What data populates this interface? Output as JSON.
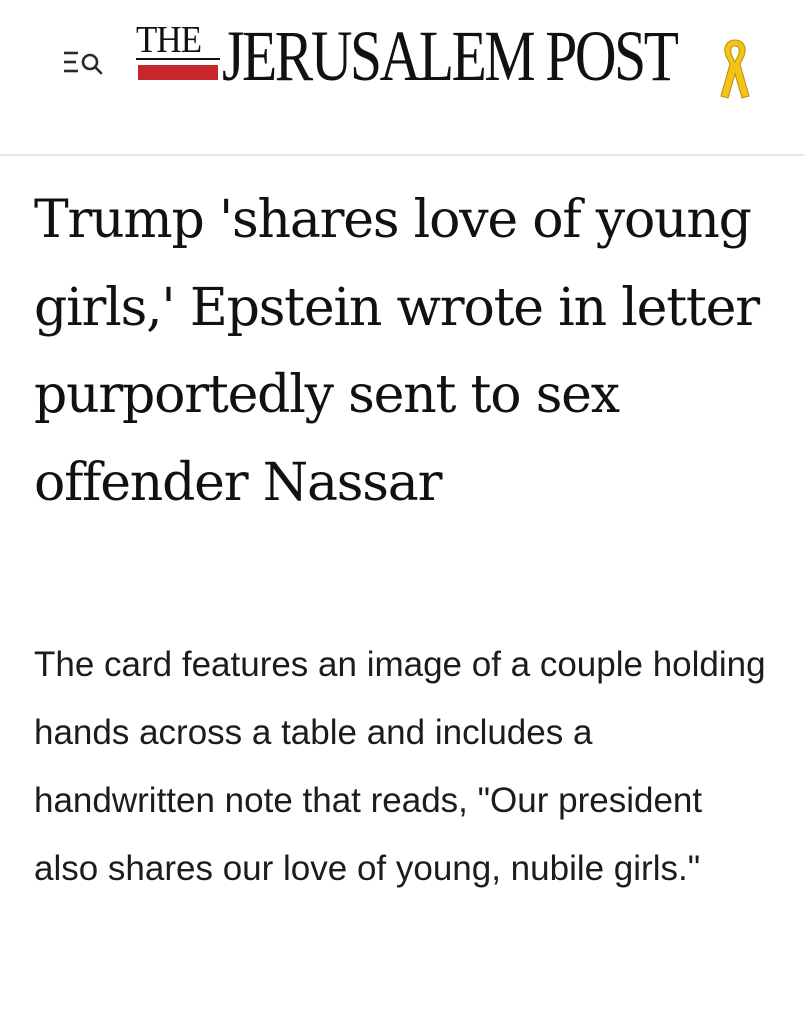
{
  "header": {
    "menu_icon": "menu-search-icon",
    "logo": {
      "the_text": "THE",
      "main_text": "JERUSALEM POST",
      "ribbon_icon": "yellow-ribbon-icon",
      "bar_color": "#c9252c",
      "ribbon_color": "#f3c317"
    }
  },
  "article": {
    "headline": "Trump 'shares love of young girls,' Epstein wrote in letter purportedly sent to sex offender Nassar",
    "summary": "The card features an image of a couple holding hands across a table and includes a handwritten note that reads, \"Our president also shares our love of young, nubile girls.\""
  }
}
